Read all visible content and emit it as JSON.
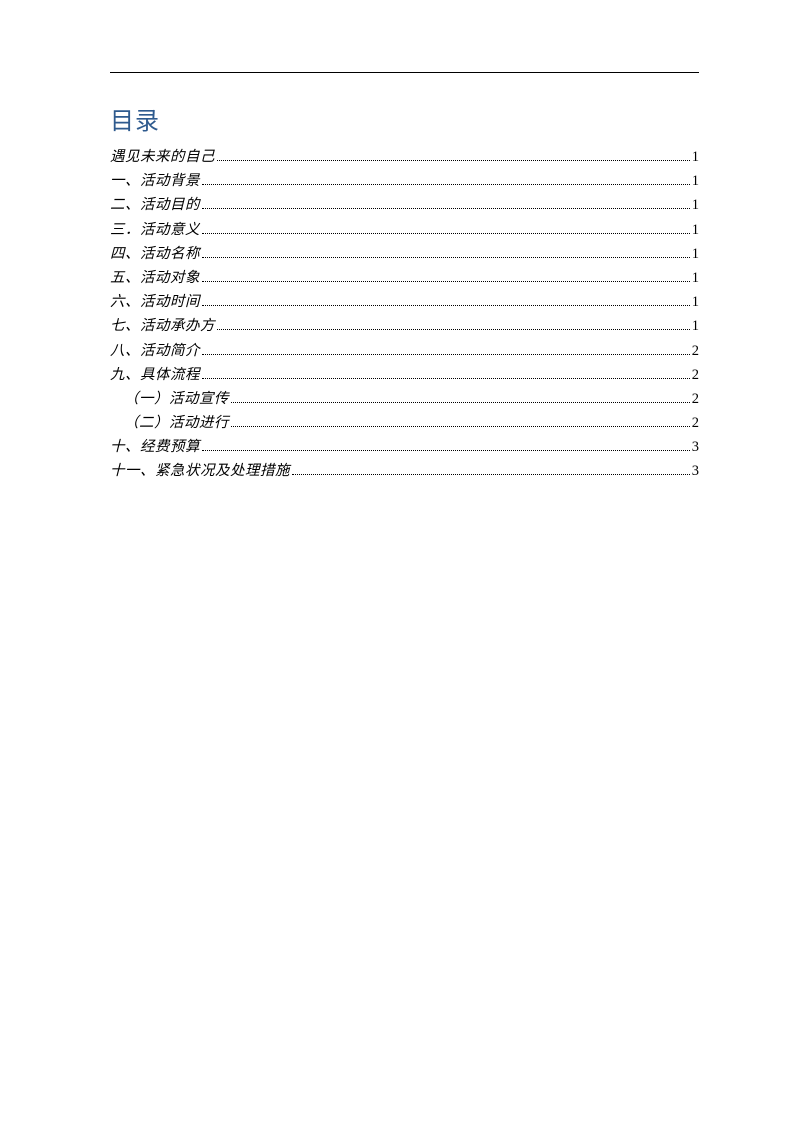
{
  "title": "目录",
  "entries": [
    {
      "label": "遇见未来的自己",
      "page": "1",
      "indent": 0
    },
    {
      "label": "一、活动背景",
      "page": "1",
      "indent": 0
    },
    {
      "label": "二、活动目的",
      "page": "1",
      "indent": 0
    },
    {
      "label": "三．活动意义",
      "page": "1",
      "indent": 0
    },
    {
      "label": "四、活动名称",
      "page": "1",
      "indent": 0
    },
    {
      "label": "五、活动对象",
      "page": "1",
      "indent": 0
    },
    {
      "label": "六、活动时间",
      "page": "1",
      "indent": 0
    },
    {
      "label": "七、活动承办方",
      "page": "1",
      "indent": 0
    },
    {
      "label": "八、活动简介",
      "page": "2",
      "indent": 0
    },
    {
      "label": "九、具体流程",
      "page": "2",
      "indent": 0
    },
    {
      "label": "（一）活动宣传",
      "page": "2",
      "indent": 1
    },
    {
      "label": "（二）活动进行",
      "page": "2",
      "indent": 1
    },
    {
      "label": "十、经费预算",
      "page": "3",
      "indent": 0
    },
    {
      "label": "十一、紧急状况及处理措施",
      "page": "3",
      "indent": 0
    }
  ]
}
